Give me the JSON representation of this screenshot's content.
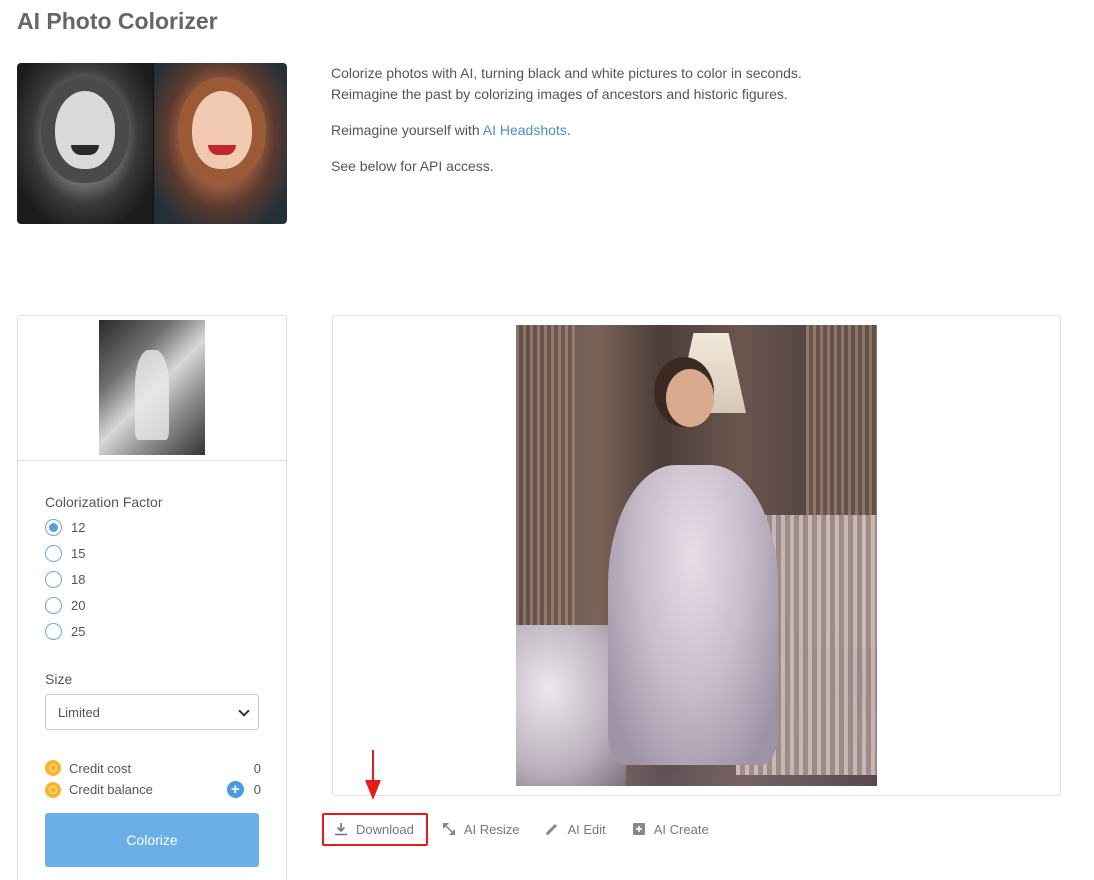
{
  "page": {
    "title": "AI Photo Colorizer"
  },
  "intro": {
    "line1": "Colorize photos with AI, turning black and white pictures to color in seconds.",
    "line2": "Reimagine the past by colorizing images of ancestors and historic figures.",
    "headshots_prefix": "Reimagine yourself with ",
    "headshots_link": "AI Headshots",
    "headshots_suffix": ".",
    "api_note": "See below for API access."
  },
  "controls": {
    "factor_label": "Colorization Factor",
    "factor_options": [
      "12",
      "15",
      "18",
      "20",
      "25"
    ],
    "factor_selected": "12",
    "size_label": "Size",
    "size_value": "Limited",
    "credit_cost_label": "Credit cost",
    "credit_cost_value": "0",
    "credit_balance_label": "Credit balance",
    "credit_balance_value": "0",
    "colorize_label": "Colorize"
  },
  "actions": {
    "download": "Download",
    "resize": "AI Resize",
    "edit": "AI Edit",
    "create": "AI Create"
  },
  "colors": {
    "accent": "#6aafe6",
    "link": "#4a90c8",
    "highlight_box": "#e31b1b",
    "coin": "#f5b62b"
  }
}
